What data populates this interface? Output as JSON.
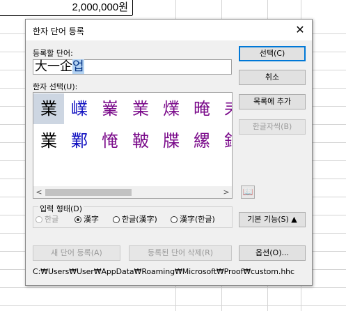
{
  "spreadsheet": {
    "cell_value": "2,000,000원"
  },
  "dialog": {
    "title": "한자 단어 등록",
    "close_glyph": "✕",
    "word_label": "등록할 단어:",
    "word_prefix": "大一企",
    "word_selected": "업",
    "hanja_label": "한자 선택(U):",
    "hanja_rows": [
      [
        "業",
        "嶫",
        "嶪",
        "業",
        "㸁",
        "晻",
        "耒"
      ],
      [
        "業",
        "鄴",
        "㤿",
        "鞁",
        "牒",
        "縲",
        "鉒"
      ]
    ],
    "scroll_left": "<",
    "scroll_right": ">",
    "buttons": {
      "select": "선택(C)",
      "cancel": "취소",
      "add_to_list": "목록에 추가",
      "hangul_jaseu": "한글자씩(B)",
      "basic_features": "기본 기능(S) ▲",
      "register_new": "새 단어 등록(A)",
      "delete_registered": "등록된 단어 삭제(R)",
      "options": "옵션(O)..."
    },
    "book_icon_glyph": "📖",
    "input_form": {
      "label": "입력 형태(D)",
      "options": [
        "한글",
        "漢字",
        "한글(漢字)",
        "漢字(한글)"
      ],
      "selected": "漢字"
    },
    "path": "C:₩Users₩User₩AppData₩Roaming₩Microsoft₩Proof₩custom.hhc"
  }
}
